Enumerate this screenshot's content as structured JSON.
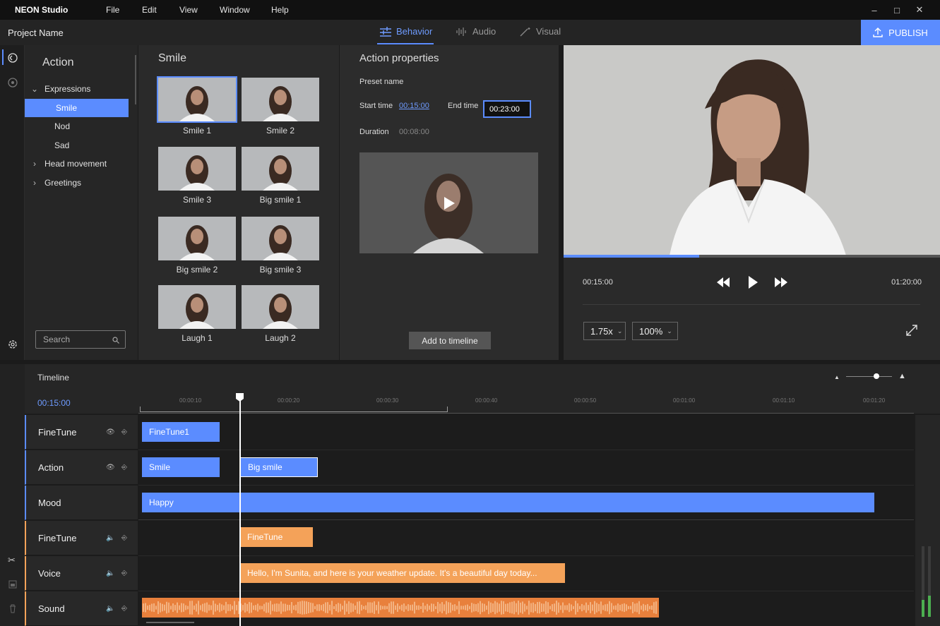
{
  "titlebar": {
    "app_name": "NEON Studio",
    "menu": [
      "File",
      "Edit",
      "View",
      "Window",
      "Help"
    ],
    "controls": [
      "minimize-icon",
      "maximize-icon",
      "close-icon"
    ]
  },
  "header": {
    "project_name": "Project Name",
    "tabs": [
      {
        "label": "Behavior",
        "icon": "sliders-icon",
        "active": true
      },
      {
        "label": "Audio",
        "icon": "waveform-icon",
        "active": false
      },
      {
        "label": "Visual",
        "icon": "magic-wand-icon",
        "active": false
      }
    ],
    "publish_label": "PUBLISH",
    "accent": "#5b8cff"
  },
  "library": {
    "title": "Action",
    "tree": [
      {
        "label": "Expressions",
        "expanded": true,
        "children": [
          "Smile",
          "Nod",
          "Sad"
        ],
        "selected": "Smile"
      },
      {
        "label": "Head movement",
        "expanded": false
      },
      {
        "label": "Greetings",
        "expanded": false
      }
    ],
    "search_placeholder": "Search"
  },
  "grid": {
    "title": "Smile",
    "items": [
      "Smile 1",
      "Smile 2",
      "Smile 3",
      "Big smile 1",
      "Big smile 2",
      "Big smile 3",
      "Laugh 1",
      "Laugh 2"
    ],
    "selected": "Smile 1"
  },
  "properties": {
    "title": "Action properties",
    "preset_label": "Preset name",
    "start_label": "Start time",
    "start_value": "00:15:00",
    "end_label": "End time",
    "end_value": "00:23:00",
    "duration_label": "Duration",
    "duration_value": "00:08:00",
    "add_button": "Add to timeline"
  },
  "preview": {
    "current_time": "00:15:00",
    "total_time": "01:20:00",
    "progress": 0.36,
    "speed": "1.75x",
    "zoom": "100%"
  },
  "timeline": {
    "title": "Timeline",
    "current_time": "00:15:00",
    "ticks": [
      "00:00:10",
      "00:00:20",
      "00:00:30",
      "00:00:40",
      "00:00:50",
      "00:01:00",
      "00:01:10",
      "00:01:20"
    ],
    "tracks": [
      {
        "label": "FineTune",
        "group": "behavior"
      },
      {
        "label": "Action",
        "group": "behavior"
      },
      {
        "label": "Mood",
        "group": "behavior"
      },
      {
        "label": "FineTune",
        "group": "audio"
      },
      {
        "label": "Voice",
        "group": "audio"
      },
      {
        "label": "Sound",
        "group": "audio"
      }
    ],
    "clips": {
      "finetune1": "FineTune1",
      "smile": "Smile",
      "big_smile": "Big smile",
      "happy": "Happy",
      "finetune_audio": "FineTune",
      "voice": "Hello, I'm Sunita, and here is your weather update. It's a beautiful day today..."
    }
  }
}
